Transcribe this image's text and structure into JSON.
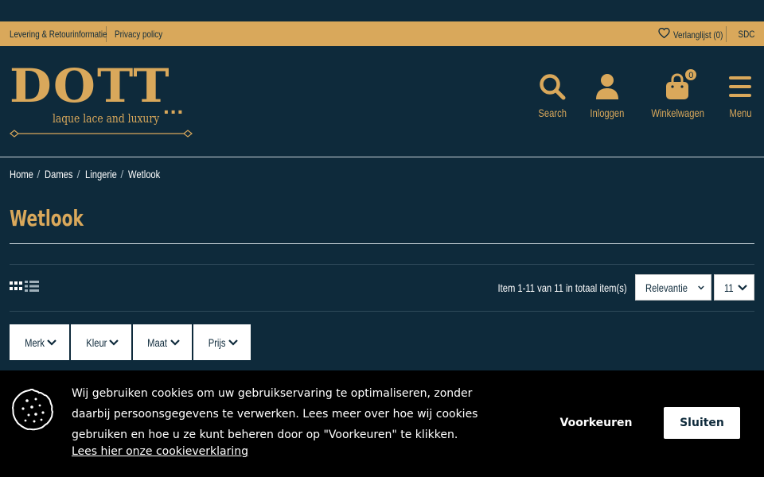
{
  "colors": {
    "background": "#0e2a3b",
    "accent": "#d9a85b",
    "cookie_bar": "#000000"
  },
  "utility_bar": {
    "delivery_link": "Levering & Retourinformatie",
    "privacy_link": "Privacy policy",
    "wishlist_label": "Verlanglijst (0)",
    "currency": "SDC"
  },
  "logo": {
    "wordmark": "DOTT",
    "dots": "...",
    "tagline": "laque lace and luxury"
  },
  "header": {
    "search_label": "Search",
    "login_label": "Inloggen",
    "cart_label": "Winkelwagen",
    "cart_count": "0",
    "menu_label": "Menu"
  },
  "breadcrumb": {
    "items": [
      "Home",
      "Dames",
      "Lingerie",
      "Wetlook"
    ]
  },
  "page_title": "Wetlook",
  "toolbar": {
    "item_count": "Item 1-11 van 11 in totaal item(s)",
    "sort_value": "Relevantie",
    "per_page_value": "11"
  },
  "filters": [
    "Merk",
    "Kleur",
    "Maat",
    "Prijs"
  ],
  "cookie": {
    "text": "Wij gebruiken cookies om uw gebruikservaring te optimaliseren, zonder daarbij persoonsgegevens te verwerken. Lees meer over hoe wij cookies gebruiken en hoe u ze kunt beheren door op \"Voorkeuren\" te klikken.",
    "link": "Lees hier onze cookieverklaring",
    "preferences_button": "Voorkeuren",
    "close_button": "Sluiten"
  }
}
